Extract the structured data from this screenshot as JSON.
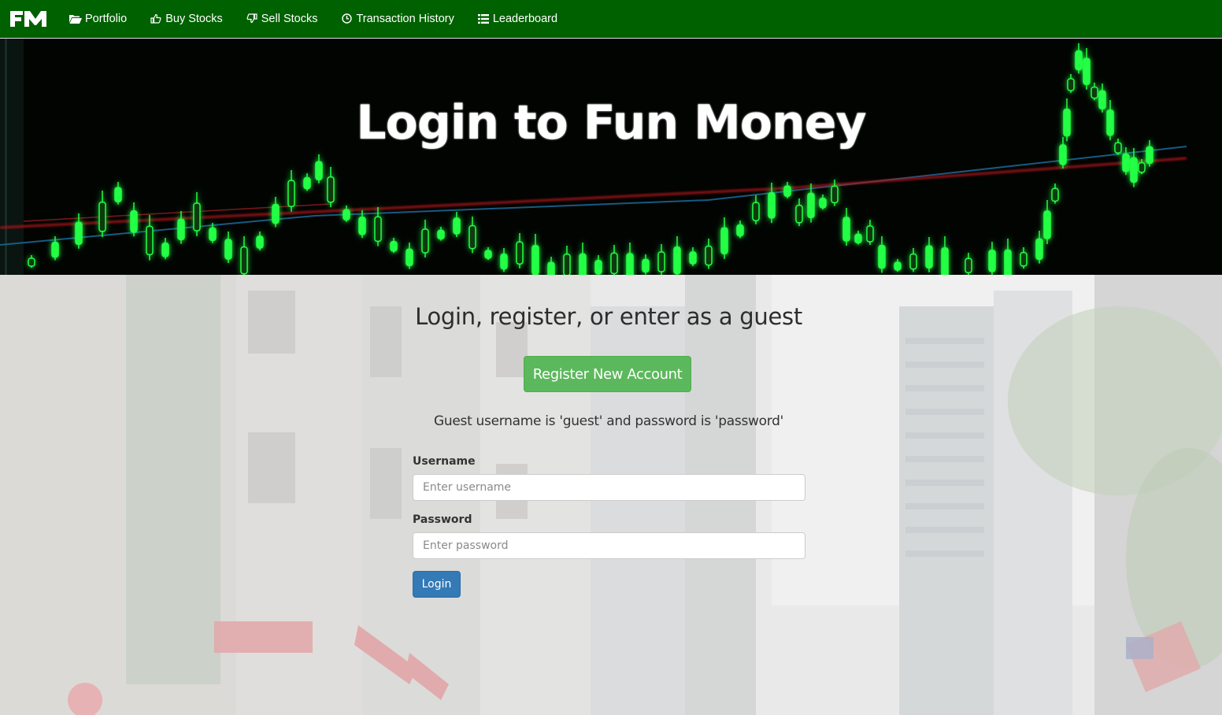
{
  "brand": {
    "logo_text": "FM"
  },
  "nav": {
    "items": [
      {
        "label": "Portfolio",
        "icon": "folder-open-icon"
      },
      {
        "label": "Buy Stocks",
        "icon": "thumbs-up-icon"
      },
      {
        "label": "Sell Stocks",
        "icon": "thumbs-down-icon"
      },
      {
        "label": "Transaction History",
        "icon": "clock-icon"
      },
      {
        "label": "Leaderboard",
        "icon": "list-icon"
      }
    ]
  },
  "hero": {
    "title": "Login to Fun Money"
  },
  "main": {
    "heading": "Login, register, or enter as a guest",
    "register_label": "Register New Account",
    "guest_note": "Guest username is 'guest' and password is 'password'"
  },
  "form": {
    "username": {
      "label": "Username",
      "placeholder": "Enter username",
      "value": ""
    },
    "password": {
      "label": "Password",
      "placeholder": "Enter password",
      "value": ""
    },
    "submit_label": "Login"
  },
  "colors": {
    "navbar": "#006100",
    "register_button": "#5cb85c",
    "login_button": "#337ab7",
    "chart_green": "#22ff44"
  }
}
